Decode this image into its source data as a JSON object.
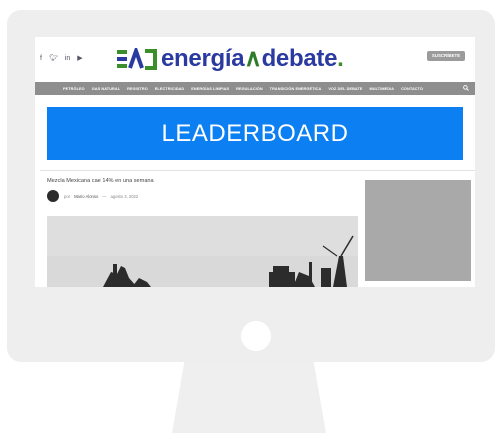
{
  "header": {
    "social_icons": [
      "facebook-icon",
      "twitter-icon",
      "linkedin-icon",
      "youtube-icon"
    ],
    "logo": {
      "part1": "energía",
      "part2": "debate",
      "suffix": "."
    },
    "subscribe_label": "SUSCRÍBETE"
  },
  "nav": {
    "items": [
      "PETRÓLEO",
      "GAS NATURAL",
      "REGISTRO",
      "ELECTRICIDAD",
      "ENERGÍAS LIMPIAS",
      "REGULACIÓN",
      "TRANSICIÓN ENERGÉTICA",
      "VOZ DEL DEBATE",
      "MULTIMEDIA",
      "CONTACTO"
    ]
  },
  "leaderboard": {
    "label": "LEADERBOARD"
  },
  "article": {
    "title": "Mezcla Mexicana cae 14% en una semana",
    "byline_prefix": "por",
    "author": "Mario Alonso",
    "separator": "—",
    "date": "agosto 3, 2022"
  },
  "colors": {
    "leaderboard_blue": "#0c7ff2",
    "logo_blue": "#2a3aa0",
    "logo_green": "#3b8f2b",
    "nav_gray": "#8e8e8e",
    "monitor_gray": "#eeeeee"
  }
}
